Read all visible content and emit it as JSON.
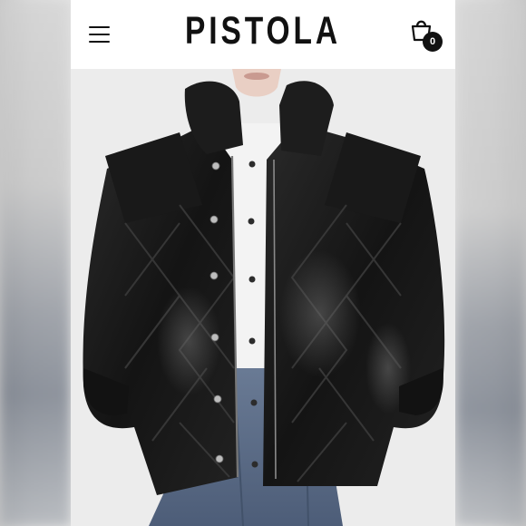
{
  "header": {
    "brand": "PISTOLA",
    "menu_icon": "hamburger-menu-icon",
    "cart_icon": "shopping-bag-icon",
    "cart_count": "0"
  },
  "product_image": {
    "description_icon": "product-photo",
    "colors": {
      "jacket": "#1a1a1a",
      "shirt": "#f4f4f4",
      "jeans": "#5a6c86",
      "background": "#ededed"
    }
  }
}
